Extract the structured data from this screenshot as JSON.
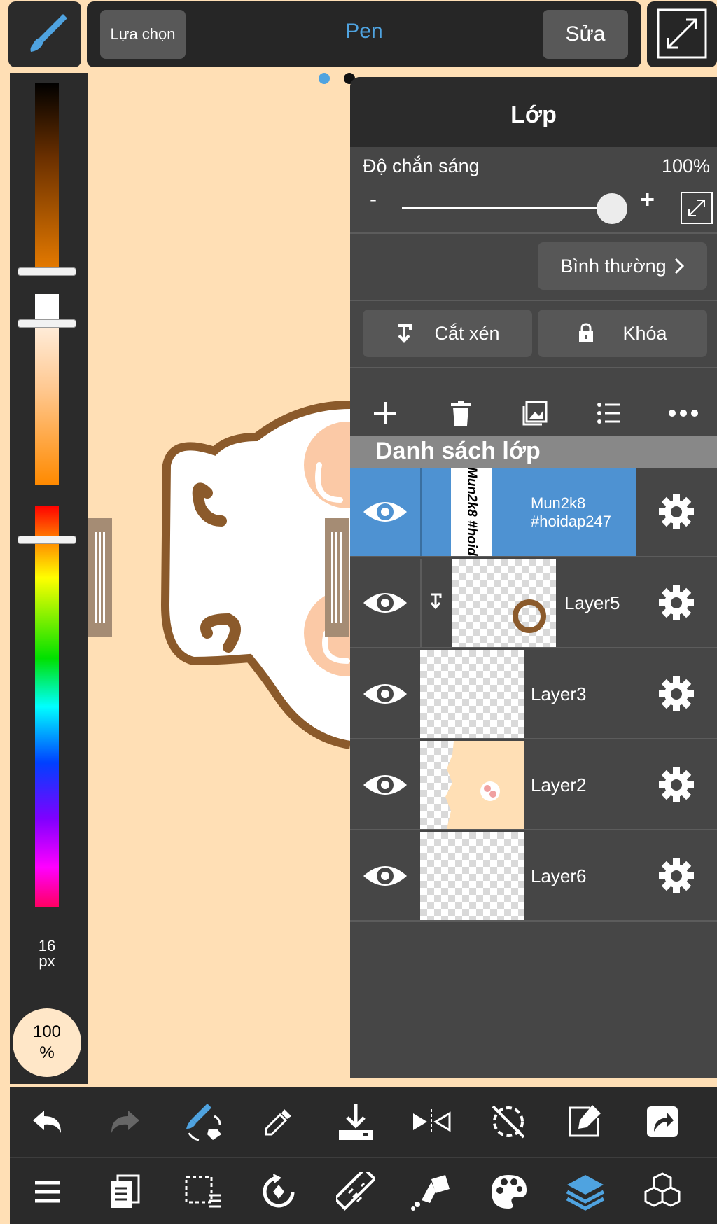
{
  "toolbar": {
    "select_label": "Lựa chọn",
    "tool_name": "Pen",
    "edit_label": "Sửa"
  },
  "left_panel": {
    "brush_size_value": "16",
    "brush_size_unit": "px",
    "opacity_value": "100",
    "opacity_unit": "%"
  },
  "layer_panel": {
    "title": "Lớp",
    "opacity_label": "Độ chắn sáng",
    "opacity_value": "100%",
    "opacity_fraction": 1.0,
    "minus_label": "-",
    "plus_label": "+",
    "blend_mode": "Bình thường",
    "clip_label": "Cắt xén",
    "lock_label": "Khóa",
    "list_title": "Danh sách lớp",
    "layers": [
      {
        "name": "Mun2k8 #hoidap247",
        "thumb_text": "Mun2k8 #hoidap247",
        "selected": true,
        "clipped": false
      },
      {
        "name": "Layer5",
        "selected": false,
        "clipped": true
      },
      {
        "name": "Layer3",
        "selected": false,
        "clipped": false
      },
      {
        "name": "Layer2",
        "selected": false,
        "clipped": false
      },
      {
        "name": "Layer6",
        "selected": false,
        "clipped": false
      }
    ]
  },
  "bottom_bar_1": [
    "undo-icon",
    "redo-icon",
    "brush-eraser-swap-icon",
    "eyedropper-icon",
    "download-icon",
    "flip-icon",
    "rotate-lock-icon",
    "edit-transform-icon",
    "share-icon"
  ],
  "bottom_bar_2": [
    "menu-icon",
    "pages-icon",
    "selection-icon",
    "rotate-canvas-icon",
    "ruler-icon",
    "fill-icon",
    "palette-icon",
    "layers-icon",
    "materials-icon"
  ],
  "colors": {
    "accent": "#4fa3e0",
    "selected_layer": "#4e92d2",
    "canvas_bg": "#ffdfb5",
    "panel_bg": "#464646"
  }
}
